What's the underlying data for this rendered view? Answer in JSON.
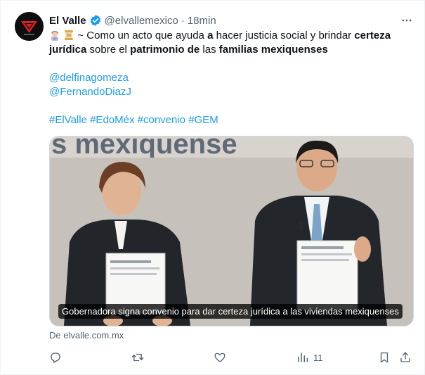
{
  "tweet": {
    "author_name": "El Valle",
    "handle": "@elvallemexico",
    "separator": "·",
    "time": "18min",
    "text_segments": [
      {
        "t": "~ Como un acto que ayuda ",
        "b": false
      },
      {
        "t": "a",
        "b": true
      },
      {
        "t": " hacer justicia social y brindar ",
        "b": false
      },
      {
        "t": "certeza jurídica",
        "b": true
      },
      {
        "t": " sobre el ",
        "b": false
      },
      {
        "t": "patrimonio de",
        "b": true
      },
      {
        "t": " las ",
        "b": false
      },
      {
        "t": "familias mexiquenses",
        "b": true
      }
    ],
    "mentions": [
      "@delfinagomeza",
      "@FernandoDiazJ"
    ],
    "hashtags": [
      "#ElValle",
      "#EdoMéx",
      "#convenio",
      "#GEM"
    ],
    "emoji_icons": [
      "woman-technologist-emoji",
      "scroll-emoji"
    ],
    "accent_color": "#1d9bf0"
  },
  "card": {
    "caption": "Gobernadora signa convenio para dar certeza jurídica a las viviendas mexiquenses",
    "banner_text": "s mexiquense",
    "domain": "De elvalle.com.mx"
  },
  "actions": {
    "reply_icon": "reply-icon",
    "retweet_icon": "retweet-icon",
    "like_icon": "heart-icon",
    "views_icon": "views-chart-icon",
    "views_count": "11",
    "bookmark_icon": "bookmark-icon",
    "share_icon": "share-icon"
  }
}
